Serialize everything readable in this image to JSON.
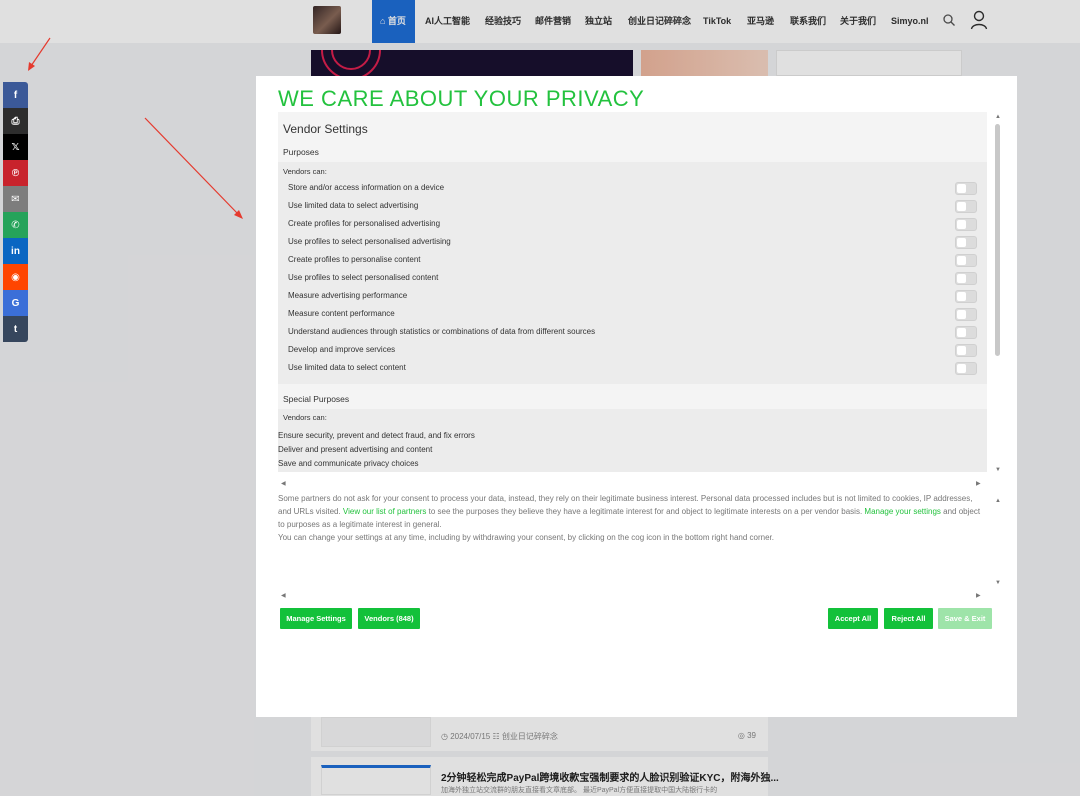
{
  "nav": {
    "items": [
      "⌂ 首页",
      "AI人工智能",
      "经验技巧",
      "邮件营销",
      "独立站",
      "创业日记碎碎念",
      "TikTok",
      "亚马逊",
      "联系我们",
      "关于我们",
      "Simyo.nl"
    ]
  },
  "share": {
    "buttons": [
      {
        "name": "facebook",
        "glyph": "f",
        "color": "#3b5998"
      },
      {
        "name": "print",
        "glyph": "⎙",
        "color": "#2d2d2d"
      },
      {
        "name": "x-twitter",
        "glyph": "𝕏",
        "color": "#000000"
      },
      {
        "name": "pinterest",
        "glyph": "℗",
        "color": "#c8232c"
      },
      {
        "name": "email",
        "glyph": "✉",
        "color": "#7d7d7d"
      },
      {
        "name": "whatsapp",
        "glyph": "✆",
        "color": "#25a35a"
      },
      {
        "name": "linkedin",
        "glyph": "in",
        "color": "#0a66c2"
      },
      {
        "name": "reddit",
        "glyph": "◉",
        "color": "#ff4500"
      },
      {
        "name": "google",
        "glyph": "G",
        "color": "#3b6fd8"
      },
      {
        "name": "tumblr",
        "glyph": "t",
        "color": "#36465d"
      }
    ]
  },
  "modal": {
    "title": "WE CARE ABOUT YOUR PRIVACY",
    "vendor_settings": "Vendor Settings",
    "purposes_label": "Purposes",
    "vendors_can": "Vendors can:",
    "purposes": [
      "Store and/or access information on a device",
      "Use limited data to select advertising",
      "Create profiles for personalised advertising",
      "Use profiles to select personalised advertising",
      "Create profiles to personalise content",
      "Use profiles to select personalised content",
      "Measure advertising performance",
      "Measure content performance",
      "Understand audiences through statistics or combinations of data from different sources",
      "Develop and improve services",
      "Use limited data to select content"
    ],
    "special_purposes_label": "Special Purposes",
    "special_vendors_can": "Vendors can:",
    "special_purposes": [
      "Ensure security, prevent and detect fraud, and fix errors",
      "Deliver and present advertising and content",
      "Save and communicate privacy choices"
    ],
    "info": {
      "p1_a": "Some partners do not ask for your consent to process your data, instead, they rely on their legitimate business interest. Personal data processed includes but is not limited to cookies, IP addresses, and URLs visited. ",
      "p1_link1": "View our list of partners",
      "p1_b": " to see the purposes they believe they have a legitimate interest for and object to legitimate interests on a per vendor basis. ",
      "p1_link2": "Manage your settings",
      "p1_c": " and object to purposes as a legitimate interest in general.",
      "p2": "You can change your settings at any time, including by withdrawing your consent, by clicking on the cog icon in the bottom right hand corner."
    },
    "buttons": {
      "manage": "Manage Settings",
      "vendors": "Vendors (848)",
      "accept": "Accept All",
      "reject": "Reject All",
      "save": "Save & Exit"
    }
  },
  "background": {
    "card1_meta": "◷ 2024/07/15  ☷ 创业日记碎碎念",
    "card1_views": "◎ 39",
    "card2_title": "2分钟轻松完成PayPal跨境收款宝强制要求的人脸识别验证KYC，附海外独...",
    "card2_excerpt": "加海外独立站交流群的朋友直接看文章底部。 最近PayPal方便直接提取中国大陆银行卡的"
  }
}
